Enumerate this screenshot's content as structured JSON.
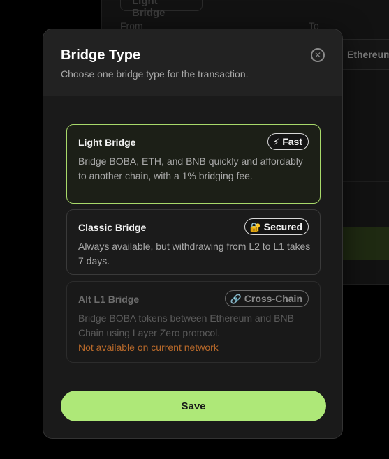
{
  "background": {
    "tab_label": "Light Bridge",
    "from_label": "From",
    "to_label": "To",
    "to_network": "Ethereum"
  },
  "modal": {
    "title": "Bridge Type",
    "subtitle": "Choose one bridge type for the transaction.",
    "close_icon": "close-circle-icon"
  },
  "options": [
    {
      "name": "Light Bridge",
      "badge_icon": "lightning-icon",
      "badge_glyph": "⚡",
      "badge_label": "Fast",
      "description": "Bridge BOBA, ETH, and BNB quickly and affordably to another chain, with a 1% bridging fee.",
      "selected": true
    },
    {
      "name": "Classic Bridge",
      "badge_icon": "lock-icon",
      "badge_glyph": "🔐",
      "badge_label": "Secured",
      "description": "Always available, but withdrawing from L2 to L1 takes 7 days.",
      "selected": false
    },
    {
      "name": "Alt L1 Bridge",
      "badge_icon": "link-icon",
      "badge_glyph": "🔗",
      "badge_label": "Cross-Chain",
      "description": "Bridge BOBA tokens between Ethereum and BNB Chain using Layer Zero protocol.",
      "note": "Not available on current network",
      "selected": false,
      "disabled": true
    }
  ],
  "save_label": "Save",
  "colors": {
    "accent": "#aee878",
    "selected_border": "#a8d96a",
    "warning_text": "#b8692a"
  }
}
